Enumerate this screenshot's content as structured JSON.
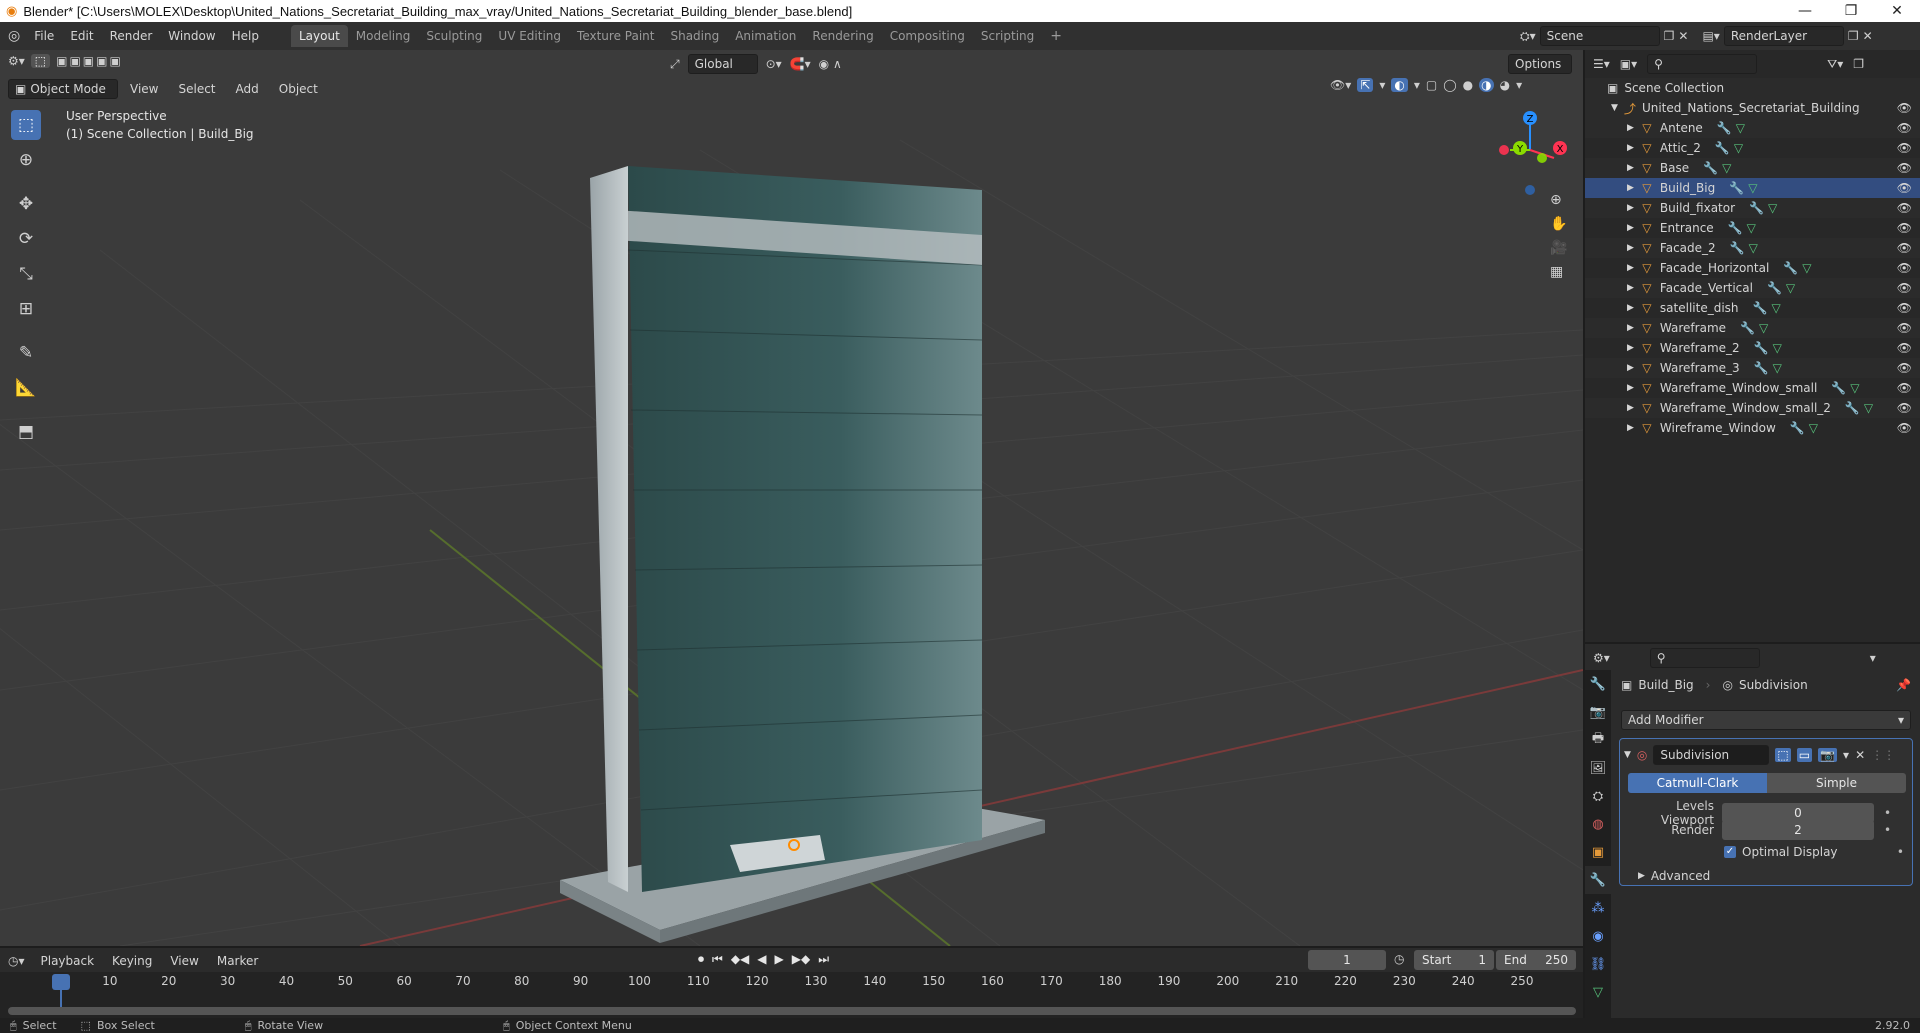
{
  "window": {
    "title": "Blender* [C:\\Users\\MOLEX\\Desktop\\United_Nations_Secretariat_Building_max_vray/United_Nations_Secretariat_Building_blender_base.blend]",
    "minimize": "—",
    "maximize": "❐",
    "close": "✕"
  },
  "menu": [
    "File",
    "Edit",
    "Render",
    "Window",
    "Help"
  ],
  "workspaces": [
    "Layout",
    "Modeling",
    "Sculpting",
    "UV Editing",
    "Texture Paint",
    "Shading",
    "Animation",
    "Rendering",
    "Compositing",
    "Scripting"
  ],
  "active_workspace": "Layout",
  "scene": {
    "name": "Scene",
    "view_layer": "RenderLayer"
  },
  "viewport": {
    "transform_orientation": "Global",
    "options_label": "Options",
    "mode": "Object Mode",
    "menus": [
      "View",
      "Select",
      "Add",
      "Object"
    ],
    "overlay_title": "User Perspective",
    "overlay_subtitle": "(1) Scene Collection | Build_Big",
    "gizmo": {
      "x": "X",
      "y": "Y",
      "z": "Z"
    }
  },
  "outliner": {
    "root": "Scene Collection",
    "collection": "United_Nations_Secretariat_Building",
    "objects": [
      "Antene",
      "Attic_2",
      "Base",
      "Build_Big",
      "Build_fixator",
      "Entrance",
      "Facade_2",
      "Facade_Horizontal",
      "Facade_Vertical",
      "satellite_dish",
      "Wareframe",
      "Wareframe_2",
      "Wareframe_3",
      "Wareframe_Window_small",
      "Wareframe_Window_small_2",
      "Wireframe_Window"
    ]
  },
  "properties": {
    "object": "Build_Big",
    "modifier_breadcrumb": "Subdivision",
    "add_modifier": "Add Modifier",
    "modifier": {
      "name": "Subdivision",
      "type_options": [
        "Catmull-Clark",
        "Simple"
      ],
      "selected_type": "Catmull-Clark",
      "levels_viewport_label": "Levels Viewport",
      "levels_viewport": "0",
      "render_label": "Render",
      "render": "2",
      "optimal_display_label": "Optimal Display",
      "optimal_display": true,
      "advanced_label": "Advanced"
    }
  },
  "timeline": {
    "menus": [
      "Playback",
      "Keying",
      "View",
      "Marker"
    ],
    "current_frame": "1",
    "start_label": "Start",
    "start": "1",
    "end_label": "End",
    "end": "250",
    "ruler": [
      "1",
      "10",
      "20",
      "30",
      "40",
      "50",
      "60",
      "70",
      "80",
      "90",
      "100",
      "110",
      "120",
      "130",
      "140",
      "150",
      "160",
      "170",
      "180",
      "190",
      "200",
      "210",
      "220",
      "230",
      "240",
      "250"
    ]
  },
  "statusbar": {
    "select": "Select",
    "box_select": "Box Select",
    "rotate_view": "Rotate View",
    "context_menu": "Object Context Menu",
    "version": "2.92.0"
  },
  "colors": {
    "accent": "#4772b3",
    "header_bg": "#303030",
    "viewport_bg": "#3b3b3b",
    "mesh_orange": "#e59a3a",
    "x_axis": "#ff3352",
    "y_axis": "#8bdc00",
    "z_axis": "#2890ff"
  }
}
